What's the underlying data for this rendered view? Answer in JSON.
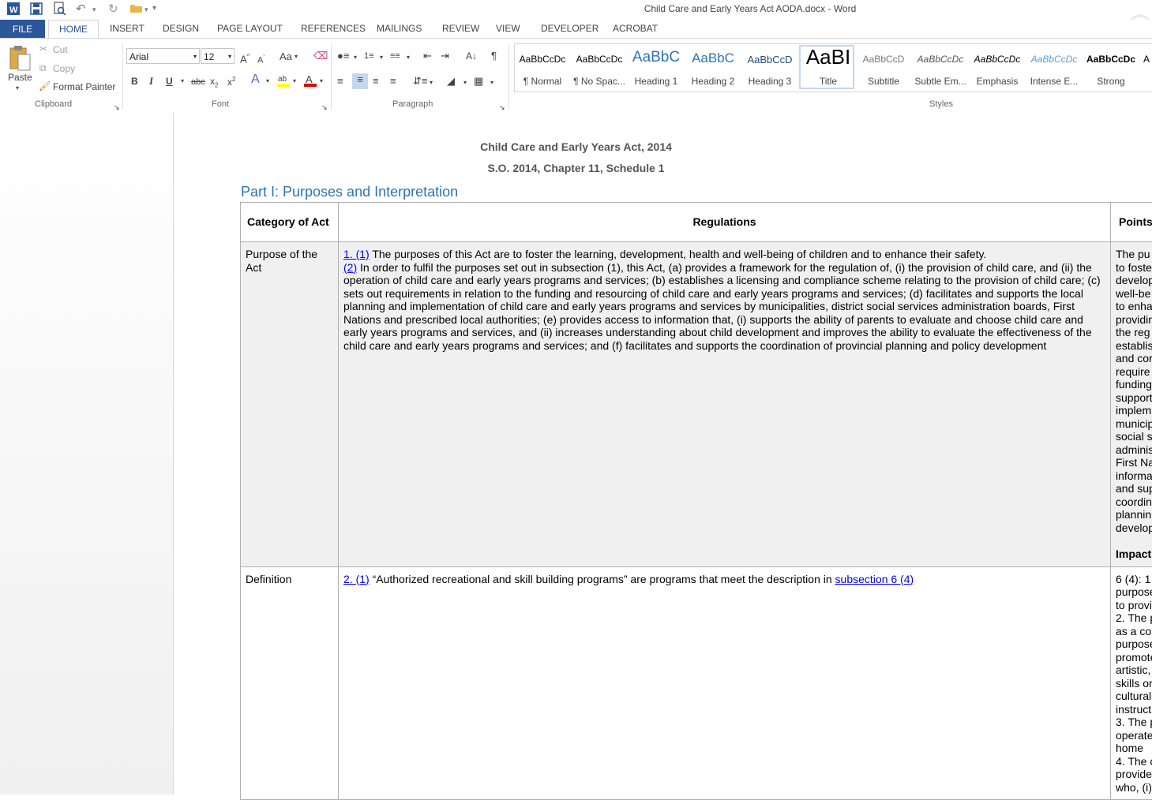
{
  "window": {
    "title": "Child Care and Early Years Act AODA.docx - Word"
  },
  "tabs": [
    "FILE",
    "HOME",
    "INSERT",
    "DESIGN",
    "PAGE LAYOUT",
    "REFERENCES",
    "MAILINGS",
    "REVIEW",
    "VIEW",
    "DEVELOPER",
    "ACROBAT"
  ],
  "clipboard": {
    "paste": "Paste",
    "cut": "Cut",
    "copy": "Copy",
    "format_painter": "Format Painter",
    "label": "Clipboard"
  },
  "font": {
    "name": "Arial",
    "size": "12",
    "label": "Font",
    "case_btn": "Aa"
  },
  "paragraph": {
    "label": "Paragraph"
  },
  "styles": {
    "label": "Styles",
    "items": [
      {
        "preview": "AaBbCcDc",
        "label": "¶ Normal"
      },
      {
        "preview": "AaBbCcDc",
        "label": "¶ No Spac..."
      },
      {
        "preview": "AaBbC",
        "label": "Heading 1"
      },
      {
        "preview": "AaBbC",
        "label": "Heading 2"
      },
      {
        "preview": "AaBbCcD",
        "label": "Heading 3"
      },
      {
        "preview": "AaBI",
        "label": "Title"
      },
      {
        "preview": "AaBbCcD",
        "label": "Subtitle"
      },
      {
        "preview": "AaBbCcDc",
        "label": "Subtle Em..."
      },
      {
        "preview": "AaBbCcDc",
        "label": "Emphasis"
      },
      {
        "preview": "AaBbCcDc",
        "label": "Intense E..."
      },
      {
        "preview": "AaBbCcDc",
        "label": "Strong"
      }
    ]
  },
  "document": {
    "header1": "Child Care and Early Years Act, 2014",
    "header2": "S.O. 2014, Chapter 11, Schedule 1",
    "part_heading": "Part I: Purposes and Interpretation",
    "table": {
      "headers": [
        "Category of Act",
        "Regulations",
        "Points"
      ],
      "row1": {
        "category": "Purpose of the Act",
        "link1": "1. (1)",
        "text1": " The purposes of this Act are to foster the learning, development, health and well-being of children and to enhance their safety.",
        "link2": "(2)",
        "text2": " In order to fulfil the purposes set out in subsection (1), this Act, (a) provides a framework for the regulation of, (i) the provision of child care, and (ii) the operation of child care and early years programs and services; (b) establishes a licensing and compliance scheme relating to the provision of child care; (c) sets out requirements in relation to the funding and resourcing of child care and early years programs and services; (d) facilitates and supports the local planning and implementation of child care and early years programs and services by municipalities, district social services administration boards, First Nations and prescribed local authorities; (e) provides access to information that, (i) supports the ability of parents to evaluate and choose child care and early years programs and services, and (ii) increases understanding about child development and improves the ability to evaluate the effectiveness of the child care and early years programs and services; and (f) facilitates and supports the coordination of provincial planning and policy development",
        "points": [
          "The pu",
          "to foste",
          "develop",
          "well-be",
          "to enha",
          "providin",
          "the reg",
          "establis",
          "and cor",
          "require",
          "funding",
          "support",
          "implem",
          "municip",
          "social s",
          "adminis",
          "First Na",
          "informa",
          "and sup",
          "coordin",
          "plannin",
          "develop"
        ],
        "impact": "Impact"
      },
      "row2": {
        "category": "Definition",
        "link1": "2. (1)",
        "text1": " “Authorized recreational and skill building programs” are programs that meet the description in ",
        "link2": "subsection 6 (4)",
        "points": [
          "6 (4): 1",
          "purpose",
          "to provi",
          "2. The p",
          "as a co",
          "purpose",
          "promote",
          "artistic,",
          "skills or",
          "cultural",
          "instruct",
          "3. The p",
          "operate",
          "home",
          "4. The c",
          "provide",
          "who, (i)"
        ]
      }
    }
  }
}
